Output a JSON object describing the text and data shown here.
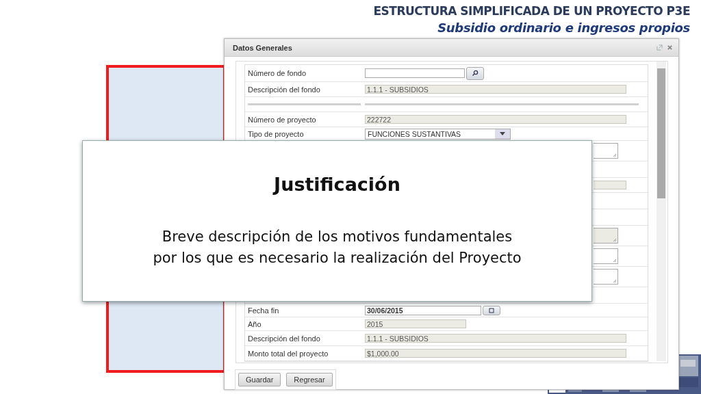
{
  "header": {
    "title": "ESTRUCTURA SIMPLIFICADA DE UN PROYECTO P3E",
    "subtitle": "Subsidio ordinario e ingresos propios"
  },
  "dialog": {
    "title": "Datos Generales",
    "rows": [
      {
        "kind": "search",
        "label": "Número de fondo"
      },
      {
        "kind": "readonly",
        "label": "Descripción del fondo",
        "value": "1.1.1 - SUBSIDIOS"
      },
      {
        "kind": "separator"
      },
      {
        "kind": "readonly",
        "label": "Número de proyecto",
        "value": "222722"
      },
      {
        "kind": "select",
        "label": "Tipo de proyecto",
        "value": "FUNCIONES SUSTANTIVAS"
      },
      {
        "kind": "textarea",
        "readonly": false
      },
      {
        "kind": "blank"
      },
      {
        "kind": "readonly"
      },
      {
        "kind": "blank"
      },
      {
        "kind": "blank"
      },
      {
        "kind": "textarea",
        "readonly": true
      },
      {
        "kind": "textarea",
        "readonly": false
      },
      {
        "kind": "textarea",
        "readonly": false
      },
      {
        "kind": "blank"
      },
      {
        "kind": "date",
        "label": "Fecha fin",
        "value": "30/06/2015"
      },
      {
        "kind": "readonly-short",
        "label": "Año",
        "value": "2015"
      },
      {
        "kind": "readonly",
        "label": "Descripción del fondo",
        "value": "1.1.1 - SUBSIDIOS"
      },
      {
        "kind": "readonly",
        "label": "Monto total del proyecto",
        "value": "$1,000.00"
      }
    ],
    "buttons": [
      "Guardar",
      "Regresar"
    ]
  },
  "callout": {
    "title": "Justificación",
    "lines": [
      "Breve descripción de los motivos fundamentales",
      "por los que es necesario la realización del Proyecto"
    ]
  }
}
